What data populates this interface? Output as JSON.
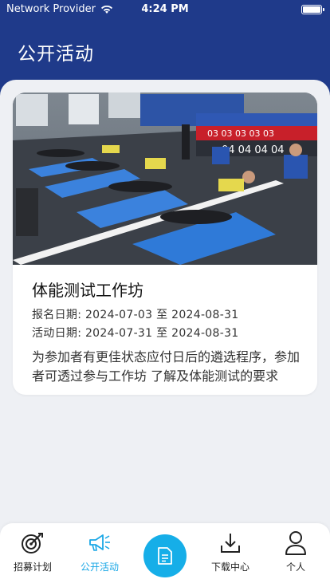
{
  "status": {
    "carrier": "Network Provider",
    "time": "4:24 PM"
  },
  "header": {
    "title": "公开活动"
  },
  "activity": {
    "title": "体能测试工作坊",
    "enroll_label": "报名日期: ",
    "enroll_dates": "2024-07-03 至 2024-08-31",
    "activity_label": "活动日期: ",
    "activity_dates": "2024-07-31 至 2024-08-31",
    "description": "为参加者有更佳状态应付日后的遴选程序，参加者可透过参与工作坊 了解及体能测试的要求"
  },
  "tabs": [
    {
      "label": "招募计划",
      "icon": "target-icon"
    },
    {
      "label": "公开活动",
      "icon": "megaphone-icon",
      "active": true
    },
    {
      "label": "",
      "icon": "document-icon"
    },
    {
      "label": "下载中心",
      "icon": "download-icon"
    },
    {
      "label": "个人",
      "icon": "user-icon"
    }
  ],
  "colors": {
    "header": "#1f3a8a",
    "accent": "#16aee8"
  }
}
